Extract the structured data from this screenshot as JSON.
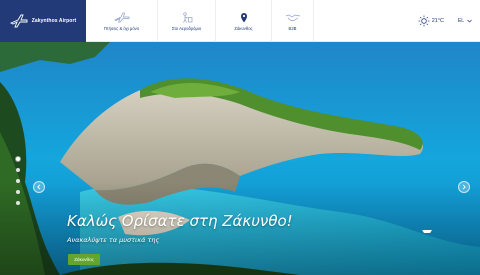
{
  "header": {
    "logo_text": "Zakynthos Airport",
    "nav": [
      {
        "label": "Πτήσεις & όχι μόνο",
        "icon": "plane-icon"
      },
      {
        "label": "Στο Αεροδρόμιο",
        "icon": "person-luggage-icon"
      },
      {
        "label": "Ζάκυνθος",
        "icon": "map-pin-icon"
      },
      {
        "label": "B2B",
        "icon": "handshake-icon"
      }
    ],
    "weather": {
      "icon": "sun-icon",
      "temperature": "21°C"
    },
    "language": "EL"
  },
  "hero": {
    "headline": "Καλώς Ορίσατε στη Ζάκυνθο!",
    "subline": "Ανακαλύψτε τα μυστικά της",
    "cta_label": "Ζάκυνθος",
    "slides_count": 5,
    "active_slide": 1
  },
  "colors": {
    "brand": "#223a78",
    "cta": "#64a52e",
    "sea": "#1ea0d8"
  }
}
